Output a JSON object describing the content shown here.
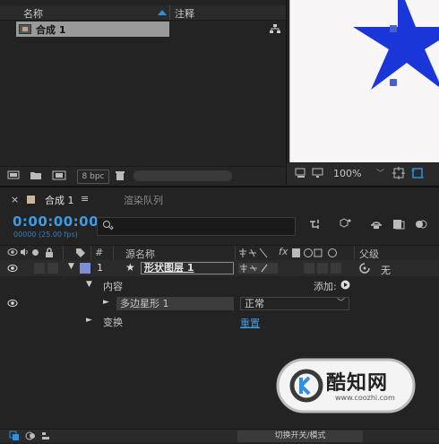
{
  "project": {
    "col_name": "名称",
    "col_comment": "注释",
    "item_label": "合成 1",
    "bpc": "8 bpc"
  },
  "viewer": {
    "zoom": "100%",
    "shape_color": "#1a35d8"
  },
  "timeline": {
    "tab_close": "×",
    "tab_comp": "合成 1",
    "tab_menu": "≡",
    "tab_render": "渲染队列",
    "timecode": "0:00:00:00",
    "fps": "00000 (25.00 fps)",
    "headers": {
      "num": "#",
      "source_name": "源名称",
      "parent": "父级",
      "fx": "fx"
    },
    "layer": {
      "number": "1",
      "name": "形状图层 1",
      "parent": "无"
    },
    "contents_label": "内容",
    "add_label": "添加:",
    "polystar_label": "多边星形 1",
    "blend_mode": "正常",
    "transform_label": "变换",
    "reset_label": "重置",
    "toggle_label": "切换开关/模式",
    "label_color": "#7d8fd6",
    "timecode_color": "#3c9ce6"
  },
  "watermark": {
    "site_name": "酷知网",
    "site_url": "www.coozhi.com"
  }
}
